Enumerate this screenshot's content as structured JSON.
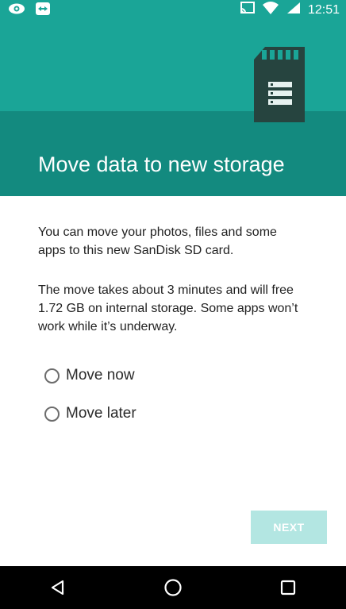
{
  "status_bar": {
    "time": "12:51",
    "icons": [
      "eye-icon",
      "teamviewer-icon",
      "cast-icon",
      "wifi-icon",
      "battery-icon"
    ]
  },
  "header": {
    "title": "Move data to new storage",
    "illustration": "sd-card-icon"
  },
  "content": {
    "paragraph1": "You can move your photos, files and some apps to this new SanDisk SD card.",
    "paragraph2": "The move takes about 3 minutes and will free 1.72 GB on internal storage. Some apps won’t work while it’s underway."
  },
  "options": [
    {
      "label": "Move now",
      "selected": false
    },
    {
      "label": "Move later",
      "selected": false
    }
  ],
  "next_button": {
    "label": "NEXT",
    "enabled": false
  },
  "colors": {
    "header": "#1aa597",
    "header_band": "#138a7f",
    "next_disabled": "#b3e6e2"
  }
}
